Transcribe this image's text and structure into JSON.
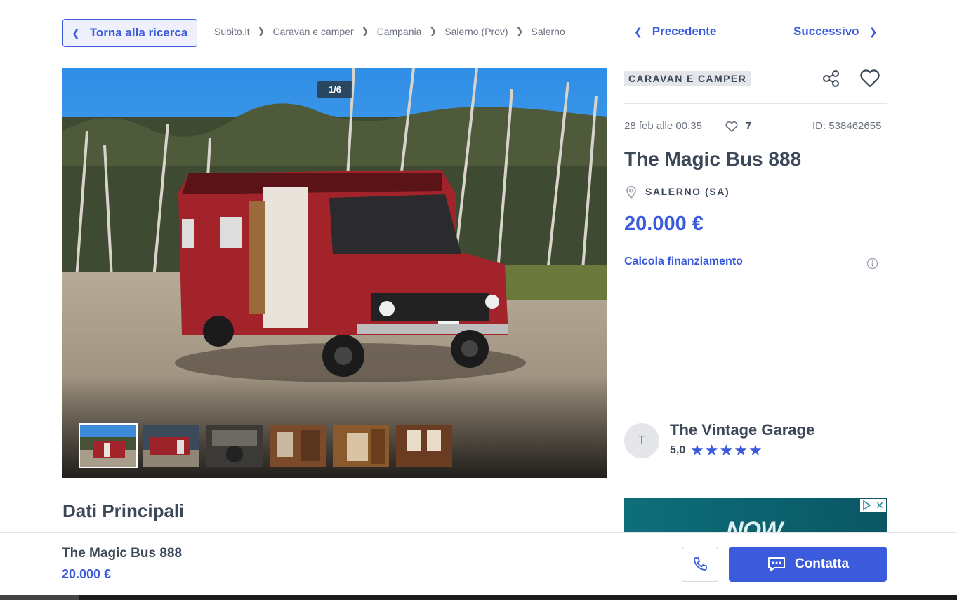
{
  "nav": {
    "back_label": "Torna alla ricerca",
    "breadcrumb": [
      "Subito.it",
      "Caravan e camper",
      "Campania",
      "Salerno (Prov)",
      "Salerno"
    ],
    "prev_label": "Precedente",
    "next_label": "Successivo"
  },
  "gallery": {
    "counter": "1/6",
    "current_index": 1,
    "total": 6
  },
  "ad": {
    "category": "CARAVAN E CAMPER",
    "date": "28 feb alle 00:35",
    "likes": "7",
    "id": "ID: 538462655",
    "title": "The Magic Bus 888",
    "location": "SALERNO (SA)",
    "price": "20.000 €",
    "finance_link": "Calcola finanziamento"
  },
  "seller": {
    "initial": "T",
    "name": "The Vintage Garage",
    "rating": "5,0",
    "stars": 5
  },
  "banner": {
    "brand": "NOW"
  },
  "section": {
    "title": "Dati Principali"
  },
  "sticky": {
    "title": "The Magic Bus 888",
    "price": "20.000 €",
    "contact_label": "Contatta"
  },
  "colors": {
    "accent": "#3c5bdc",
    "text": "#3c4858",
    "muted": "#6b7280"
  },
  "icons": [
    "chevron-left-icon",
    "chevron-right-icon",
    "share-icon",
    "heart-icon",
    "location-pin-icon",
    "info-icon",
    "star-icon",
    "phone-icon",
    "chat-icon",
    "ad-choices-icon",
    "close-icon"
  ]
}
